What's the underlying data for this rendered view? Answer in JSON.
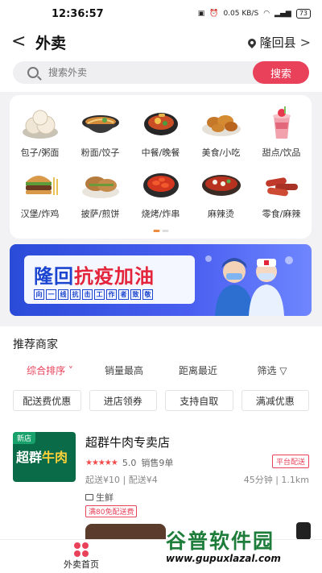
{
  "status": {
    "time": "12:36:57",
    "speed": "0.05 KB/S",
    "battery": "73"
  },
  "header": {
    "back_label": "<",
    "title": "外卖",
    "location": "隆回县",
    "chevron": ">"
  },
  "search": {
    "placeholder": "搜索外卖",
    "button": "搜索"
  },
  "categories": [
    {
      "label": "包子/粥面",
      "icon": "steamed-bun-icon"
    },
    {
      "label": "粉面/饺子",
      "icon": "noodle-bowl-icon"
    },
    {
      "label": "中餐/晚餐",
      "icon": "dinner-pot-icon"
    },
    {
      "label": "美食/小吃",
      "icon": "fried-snack-icon"
    },
    {
      "label": "甜点/饮品",
      "icon": "drink-cup-icon"
    },
    {
      "label": "汉堡/炸鸡",
      "icon": "burger-icon"
    },
    {
      "label": "披萨/煎饼",
      "icon": "pizza-sandwich-icon"
    },
    {
      "label": "烧烤/炸串",
      "icon": "crayfish-bowl-icon"
    },
    {
      "label": "麻辣烫",
      "icon": "hotpot-icon"
    },
    {
      "label": "零食/麻辣",
      "icon": "sausage-icon"
    }
  ],
  "banner": {
    "title_part1": "隆回",
    "title_part2": "抗疫加油",
    "subtitle_chars": [
      "向",
      "一",
      "线",
      "抗",
      "击",
      "工",
      "作",
      "者",
      "致",
      "敬"
    ]
  },
  "section": {
    "title": "推荐商家"
  },
  "sort": [
    "综合排序",
    "销量最高",
    "距离最近",
    "筛选"
  ],
  "filters": [
    "配送费优惠",
    "进店领券",
    "支持自取",
    "满减优惠"
  ],
  "shop": {
    "tag": "新店",
    "logo_text1": "超群",
    "logo_text2": "牛肉",
    "name": "超群牛肉专卖店",
    "stars": "★★★★★",
    "score": "5.0",
    "sales": "销售9单",
    "platform": "平台配送",
    "price": "起送¥10 | 配送¥4",
    "time_distance": "45分钟 | 1.1km",
    "category": "生鲜",
    "promo": "满80免配送费"
  },
  "bottom_nav": {
    "home_label": "外卖首页"
  },
  "watermark": {
    "main": "谷普软件园",
    "url": "www.gupuxlazal.com"
  },
  "colors": {
    "accent": "#e9415a",
    "banner_blue": "#2a4bd8"
  }
}
